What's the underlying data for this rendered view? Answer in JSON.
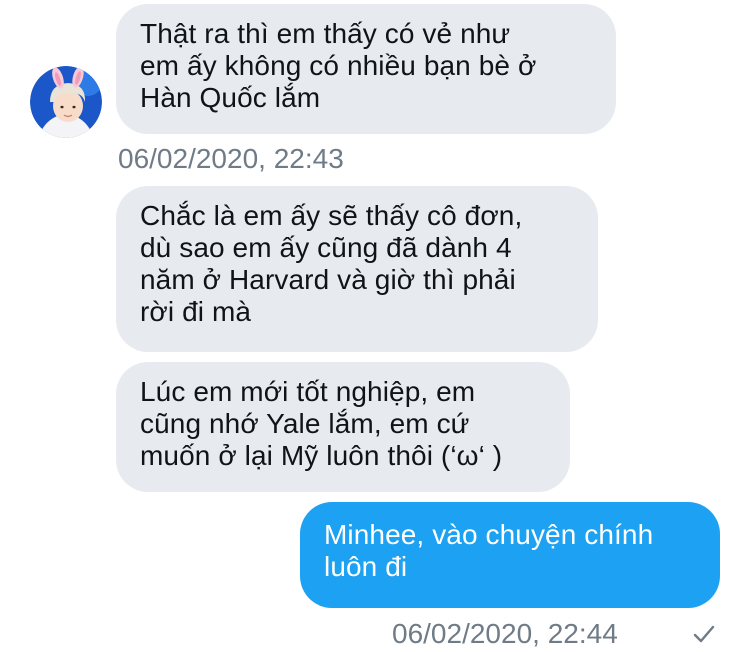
{
  "conversation": {
    "avatar_icon": "user-avatar-icon",
    "colors": {
      "incoming_bubble": "#e7ebef",
      "outgoing_bubble": "#1da1f2",
      "timestamp": "#6f7b86"
    },
    "messages": [
      {
        "direction": "incoming",
        "lines": [
          "Thật ra thì em thấy có vẻ như",
          "em ấy không có nhiều bạn bè ở",
          "Hàn Quốc lắm"
        ]
      },
      {
        "direction": "incoming",
        "lines": [
          "Chắc là em ấy sẽ thấy cô đơn,",
          "dù sao em ấy cũng đã dành 4",
          "năm ở Harvard và giờ thì phải",
          "rời đi mà"
        ]
      },
      {
        "direction": "incoming",
        "lines": [
          "Lúc em mới tốt nghiệp, em",
          "cũng nhớ Yale lắm, em cứ",
          "muốn ở lại Mỹ luôn thôi (‘ω‘ )"
        ]
      },
      {
        "direction": "outgoing",
        "lines": [
          "Minhee, vào chuyện chính",
          "luôn đi"
        ]
      }
    ],
    "timestamps": {
      "incoming": "06/02/2020, 22:43",
      "outgoing": "06/02/2020, 22:44"
    },
    "sent_status_icon": "checkmark-icon"
  }
}
